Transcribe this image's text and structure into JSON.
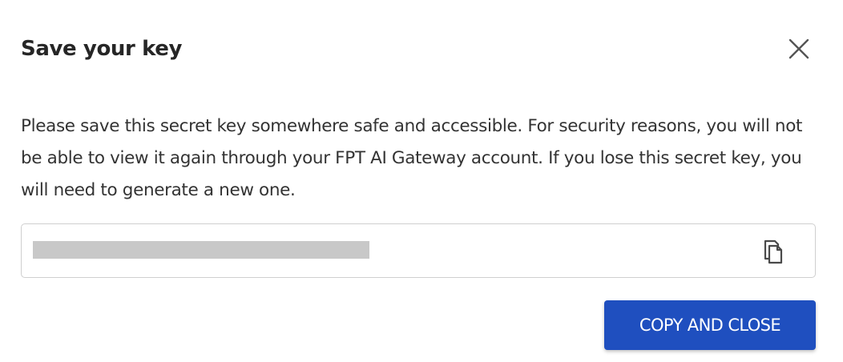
{
  "dialog": {
    "title": "Save your key",
    "description": "Please save this secret key somewhere safe and accessible. For security reasons, you will not be able to view it again through your FPT AI Gateway account. If you lose this secret key, you will need to generate a new one.",
    "key_field": {
      "value": "",
      "redacted": true
    },
    "primary_button_label": "COPY AND CLOSE",
    "icons": {
      "close": "close-icon",
      "copy": "copy-icon"
    },
    "colors": {
      "primary": "#1f4fbf",
      "redaction": "#c8c8c8",
      "border": "#cfcfcf"
    }
  }
}
